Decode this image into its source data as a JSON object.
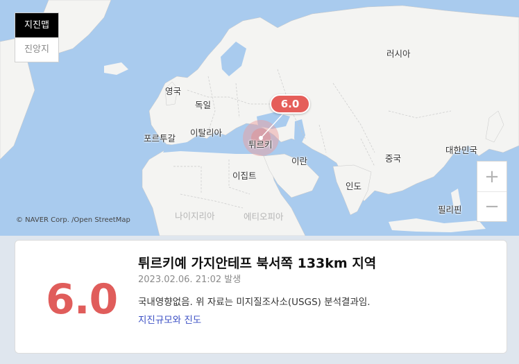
{
  "toggle": {
    "options": [
      "지진맵",
      "진앙지"
    ],
    "active": "지진맵"
  },
  "map": {
    "labels": {
      "russia": "러시아",
      "uk": "영국",
      "germany": "독일",
      "portugal": "포르투갈",
      "italy": "이탈리아",
      "turkey": "튀르키",
      "iran": "이란",
      "china": "중국",
      "korea": "대한민국",
      "egypt": "이집트",
      "india": "인도",
      "philippines": "필리핀",
      "nigeria": "나이지리아",
      "ethiopia": "에티오피아"
    },
    "attribution": "© NAVER Corp. /Open StreetMap",
    "badge": "6.0",
    "zoom_in": "+",
    "zoom_out": "−"
  },
  "card": {
    "magnitude": "6.0",
    "title": "튀르키예 가지안테프 북서쪽 133km 지역",
    "time": "2023.02.06. 21:02 발생",
    "note": "국내영향없음. 위 자료는 미지질조사소(USGS) 분석결과임.",
    "link": "지진규모와 진도"
  },
  "colors": {
    "accent": "#e55e5a",
    "link": "#3b4fc4",
    "water": "#a9cbee",
    "land": "#f4f4f2"
  }
}
